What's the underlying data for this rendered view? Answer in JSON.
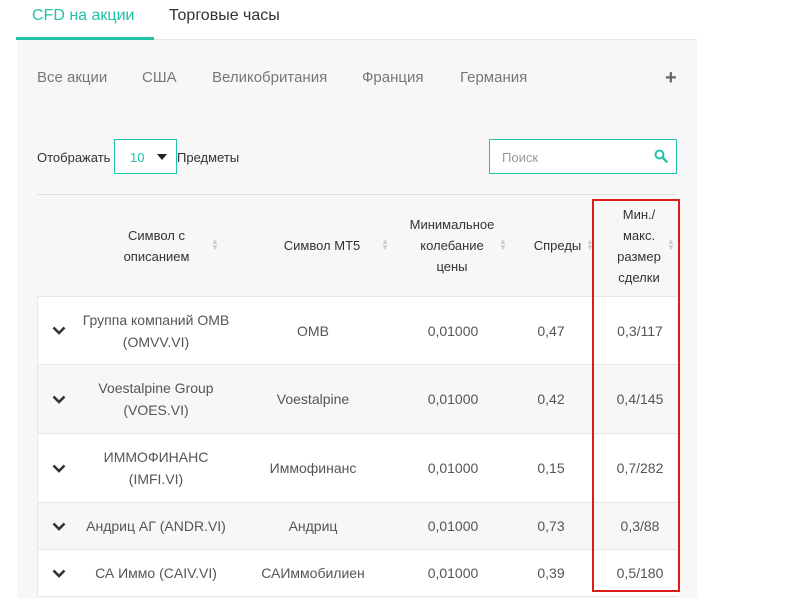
{
  "tabs": [
    {
      "label": "CFD на акции",
      "active": true
    },
    {
      "label": "Торговые часы",
      "active": false
    }
  ],
  "filters": [
    "Все акции",
    "США",
    "Великобритания",
    "Франция",
    "Германия"
  ],
  "add_icon": "plus-icon",
  "show": {
    "label": "Отображать",
    "value": "10",
    "items_label": "Предметы"
  },
  "search": {
    "placeholder": "Поиск",
    "icon": "search-icon"
  },
  "table": {
    "headers": [
      "Символ с описанием",
      "Символ MT5",
      "Минимальное колебание цены",
      "Спреды",
      "Мин./ макс. размер сделки"
    ],
    "rows": [
      {
        "description": "Группа компаний OMB (OMVV.VI)",
        "mt5": "OMB",
        "min_tick": "0,01000",
        "spread": "0,47",
        "size": "0,3/117"
      },
      {
        "description": "Voestalpine Group (VOES.VI)",
        "mt5": "Voestalpine",
        "min_tick": "0,01000",
        "spread": "0,42",
        "size": "0,4/145"
      },
      {
        "description": "ИММОФИНАНС (IMFI.VI)",
        "mt5": "Иммофинанс",
        "min_tick": "0,01000",
        "spread": "0,15",
        "size": "0,7/282"
      },
      {
        "description": "Андриц АГ (ANDR.VI)",
        "mt5": "Андриц",
        "min_tick": "0,01000",
        "spread": "0,73",
        "size": "0,3/88"
      },
      {
        "description": "СА Иммо (CAIV.VI)",
        "mt5": "САИммобилиен",
        "min_tick": "0,01000",
        "spread": "0,39",
        "size": "0,5/180"
      }
    ]
  },
  "colors": {
    "accent": "#22c3a6",
    "highlight": "#e01b1b"
  }
}
